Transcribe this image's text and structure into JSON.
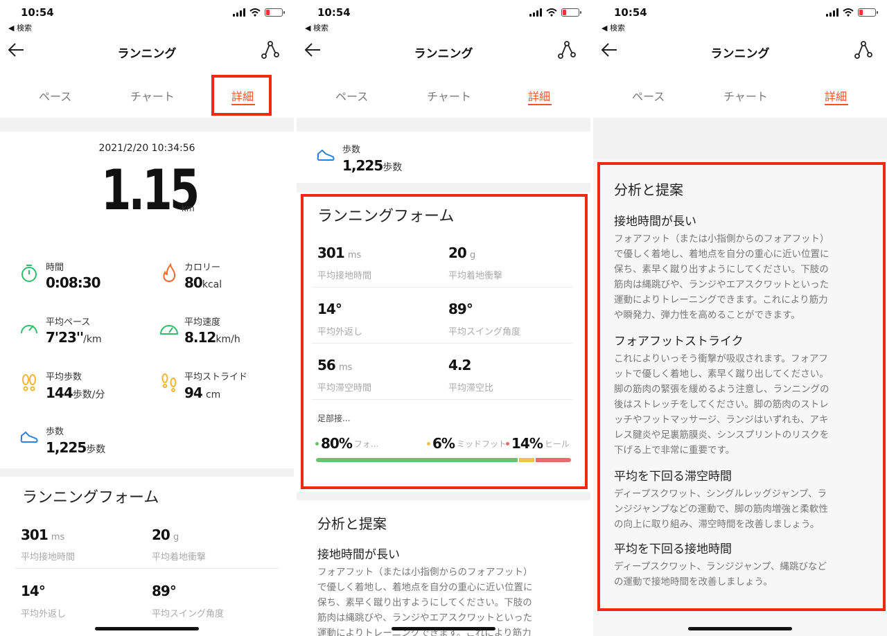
{
  "status": {
    "time": "10:54",
    "back": "◀ 検索"
  },
  "nav": {
    "title": "ランニング"
  },
  "tabs": {
    "pace": "ペース",
    "chart": "チャート",
    "detail": "詳細"
  },
  "summary": {
    "datetime": "2021/2/20 10:34:56",
    "distance": "1.15",
    "distance_unit": "km"
  },
  "stats": {
    "time": {
      "label": "時間",
      "value": "0:08:30",
      "unit": ""
    },
    "calories": {
      "label": "カロリー",
      "value": "80",
      "unit": "kcal"
    },
    "avg_pace": {
      "label": "平均ペース",
      "value": "7'23''",
      "unit": "/km"
    },
    "avg_speed": {
      "label": "平均速度",
      "value": "8.12",
      "unit": "km/h"
    },
    "avg_cadence": {
      "label": "平均歩数",
      "value": "144",
      "unit": "歩数/分"
    },
    "avg_stride": {
      "label": "平均ストライド",
      "value": "94",
      "unit": "cm"
    },
    "steps": {
      "label": "歩数",
      "value": "1,225",
      "unit": "歩数"
    }
  },
  "running_form": {
    "title": "ランニングフォーム",
    "ground_contact": {
      "value": "301",
      "unit": "ms",
      "label": "平均接地時間"
    },
    "impact": {
      "value": "20",
      "unit": "g",
      "label": "平均着地衝撃"
    },
    "eversion": {
      "value": "14°",
      "label": "平均外返し"
    },
    "swing": {
      "value": "89°",
      "label": "平均スイング角度"
    },
    "flight_time": {
      "value": "56",
      "unit": "ms",
      "label": "平均滞空時間"
    },
    "flight_ratio": {
      "value": "4.2",
      "label": "平均滞空比"
    },
    "foot_strike": {
      "label": "足部接...",
      "forefoot": {
        "pct": "80%",
        "name": "フォ...",
        "fraction": 0.8
      },
      "midfoot": {
        "pct": "6%",
        "name": "ミッドフット",
        "fraction": 0.06
      },
      "heel": {
        "pct": "14%",
        "name": "ヒール",
        "fraction": 0.14
      }
    }
  },
  "analysis": {
    "title": "分析と提案",
    "items": [
      {
        "heading": "接地時間が長い",
        "lines": [
          "フォアフット（または小指側からのフォアフット）",
          "で優しく着地し、着地点を自分の重心に近い位置に",
          "保ち、素早く蹴り出すようにしてください。下肢の",
          "筋肉は縄跳びや、ランジやエアスクワットといった",
          "運動によりトレーニングできます。これにより筋力",
          "や瞬発力、弾力性を高めることができます。"
        ]
      },
      {
        "heading": "フォアフットストライク",
        "lines": [
          "これによりいっそう衝撃が吸収されます。フォアフ",
          "ットで優しく着地し、素早く蹴り出してください。",
          "脚の筋肉の緊張を緩めるよう注意し、ランニングの",
          "後はストレッチをしてください。脚の筋肉のストレ",
          "ッチやフットマッサージ、ランジはいずれも、アキ",
          "レス腱炎や足裏筋膜炎、シンスプリントのリスクを",
          "下げる上で非常に重要です。"
        ]
      },
      {
        "heading": "平均を下回る滞空時間",
        "lines": [
          "ディープスクワット、シングルレッグジャンプ、ラ",
          "ンジジャンプなどの運動で、脚の筋肉増強と柔軟性",
          "の向上に取り組み、滞空時間を改善しましょう。"
        ]
      },
      {
        "heading": "平均を下回る接地時間",
        "lines": [
          "ディープスクワット、ランジジャンプ、縄跳びなど",
          "の運動で接地時間を改善しましょう。"
        ]
      }
    ]
  },
  "colors": {
    "accent": "#e8562a",
    "highlight": "#ee2a12",
    "forefoot": "#6cc070",
    "midfoot": "#f2c14e",
    "heel": "#e86a6a"
  }
}
